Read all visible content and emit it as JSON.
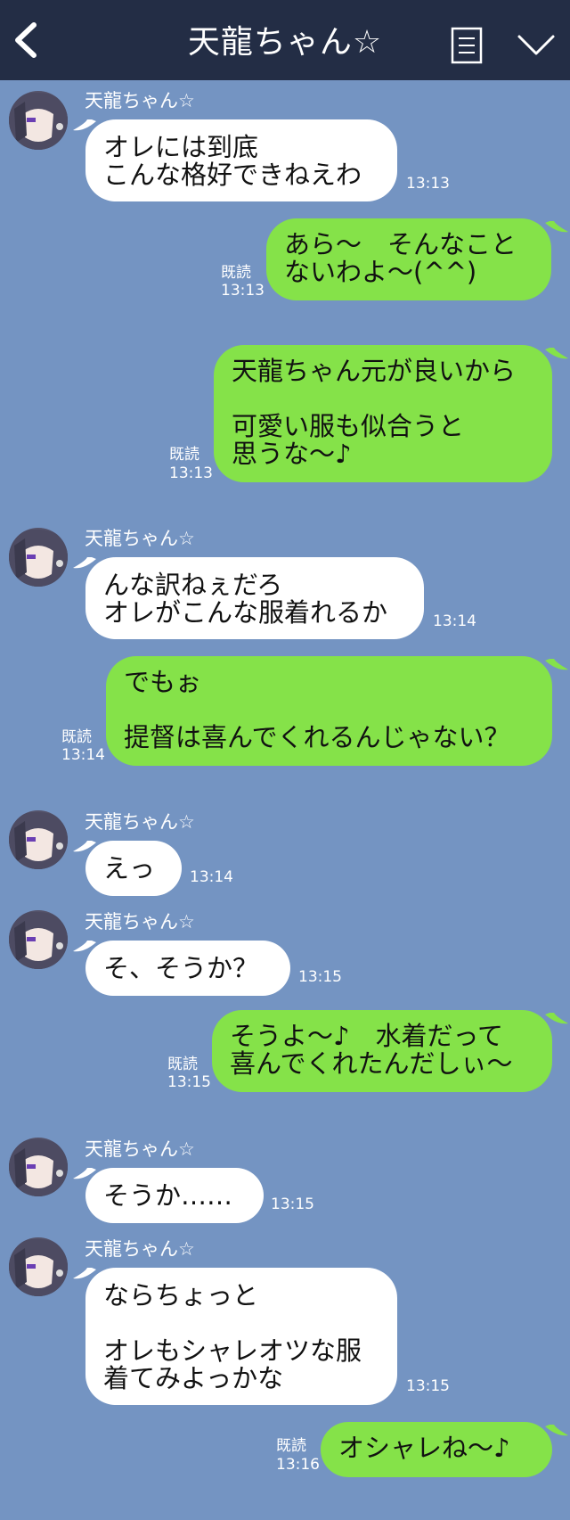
{
  "header": {
    "title": "天龍ちゃん☆",
    "back_icon": "chevron-left-icon",
    "menu_icon": "document-list-icon",
    "more_icon": "chevron-down-icon"
  },
  "colors": {
    "background": "#7494c2",
    "header": "#232d45",
    "incoming_bubble": "#ffffff",
    "outgoing_bubble": "#85e249"
  },
  "messages": [
    {
      "direction": "in",
      "sender": "天龍ちゃん☆",
      "text": "オレには到底\nこんな格好できねえわ",
      "time": "13:13"
    },
    {
      "direction": "out",
      "read": "既読",
      "text": "あら〜　そんなこと\nないわよ〜(^^)",
      "time": "13:13"
    },
    {
      "direction": "out",
      "read": "既読",
      "text": "天龍ちゃん元が良いから\n\n可愛い服も似合うと\n思うな〜♪",
      "time": "13:13"
    },
    {
      "direction": "in",
      "sender": "天龍ちゃん☆",
      "text": "んな訳ねぇだろ\nオレがこんな服着れるか",
      "time": "13:14"
    },
    {
      "direction": "out",
      "read": "既読",
      "text": "でもぉ\n\n提督は喜んでくれるんじゃない？",
      "time": "13:14"
    },
    {
      "direction": "in",
      "sender": "天龍ちゃん☆",
      "text": "えっ",
      "time": "13:14"
    },
    {
      "direction": "in",
      "sender": "天龍ちゃん☆",
      "text": "そ、そうか？",
      "time": "13:15"
    },
    {
      "direction": "out",
      "read": "既読",
      "text": "そうよ〜♪　水着だって\n喜んでくれたんだしぃ〜",
      "time": "13:15"
    },
    {
      "direction": "in",
      "sender": "天龍ちゃん☆",
      "text": "そうか……",
      "time": "13:15"
    },
    {
      "direction": "in",
      "sender": "天龍ちゃん☆",
      "text": "ならちょっと\n\nオレもシャレオツな服\n着てみよっかな",
      "time": "13:15"
    },
    {
      "direction": "out",
      "read": "既読",
      "text": "オシャレね〜♪",
      "time": "13:16"
    }
  ]
}
